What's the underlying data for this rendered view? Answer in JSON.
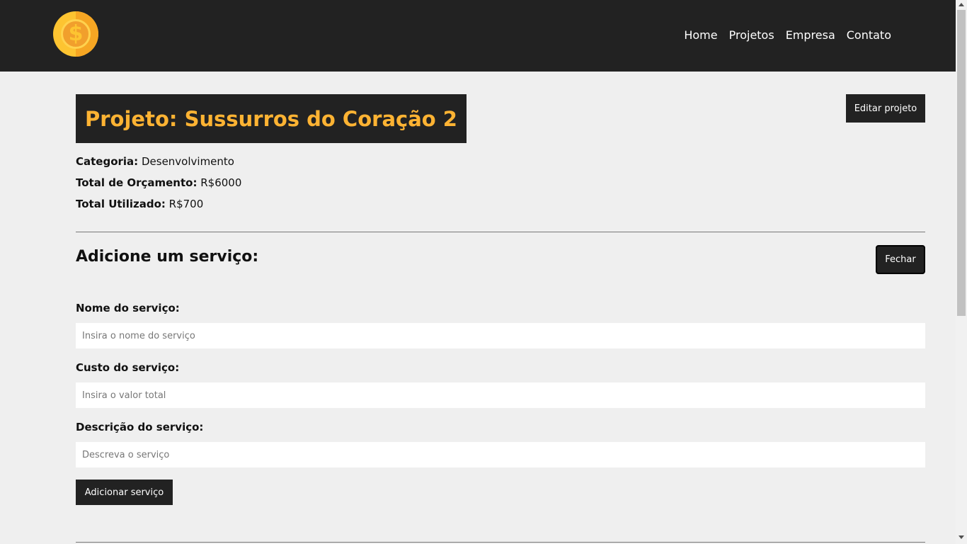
{
  "header": {
    "logo_icon": "dollar-coin-icon",
    "nav": [
      "Home",
      "Projetos",
      "Empresa",
      "Contato"
    ]
  },
  "project": {
    "title": "Projeto: Sussurros do Coração 2",
    "edit_button": "Editar projeto",
    "category_label": "Categoria:",
    "category_value": "Desenvolvimento",
    "budget_label": "Total de Orçamento:",
    "budget_value": "R$6000",
    "used_label": "Total Utilizado:",
    "used_value": "R$700"
  },
  "service_form": {
    "section_title": "Adicione um serviço:",
    "close_button": "Fechar",
    "name_label": "Nome do serviço:",
    "name_placeholder": "Insira o nome do serviço",
    "cost_label": "Custo do serviço:",
    "cost_placeholder": "Insira o valor total",
    "description_label": "Descrição do serviço:",
    "description_placeholder": "Descreva o serviço",
    "submit_button": "Adicionar serviço"
  },
  "colors": {
    "navbar": "#222222",
    "title_accent": "#fdb333",
    "background": "#efefef"
  }
}
